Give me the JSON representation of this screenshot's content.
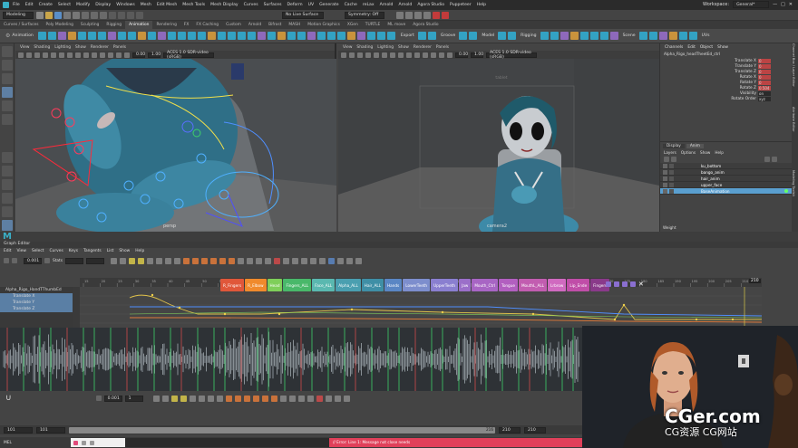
{
  "app": {
    "menu": [
      "File",
      "Edit",
      "Create",
      "Select",
      "Modify",
      "Display",
      "Windows",
      "Mesh",
      "Edit Mesh",
      "Mesh Tools",
      "Mesh Display",
      "Curves",
      "Surfaces",
      "Deform",
      "UV",
      "Generate",
      "Cache",
      "reLax",
      "Arnold",
      "Arnold",
      "Agora Studio",
      "Puppeteer",
      "Help"
    ],
    "workspace_label": "Workspace:",
    "workspace_value": "General*",
    "window_controls": [
      "—",
      "□",
      "✕"
    ]
  },
  "statusline": {
    "mode": "Modeling",
    "live_surface": "No Live Surface",
    "symmetry": "Symmetry: Off"
  },
  "shelf_tabs": [
    "Curves / Surfaces",
    "Poly Modeling",
    "Sculpting",
    "Rigging",
    "Animation",
    "Rendering",
    "FX",
    "FX Caching",
    "Custom",
    "Arnold",
    "Bifrost",
    "MASH",
    "Motion Graphics",
    "XGen",
    "TURTLE",
    "ML move",
    "Agora Studio"
  ],
  "shelf": {
    "animation_label": "Animation",
    "export_label": "Export",
    "groove_label": "Groove",
    "model_label": "Model",
    "rigging_label": "Rigging",
    "scene_label": "Scene",
    "uvs_label": "UVs"
  },
  "viewport_left": {
    "menu": [
      "View",
      "Shading",
      "Lighting",
      "Show",
      "Renderer",
      "Panels"
    ],
    "values": [
      "0.00",
      "1.00"
    ],
    "colorspace": "ACES 1.0 SDR-video (sRGB)",
    "camera": "persp"
  },
  "viewport_right": {
    "menu": [
      "View",
      "Shading",
      "Lighting",
      "Show",
      "Renderer",
      "Panels"
    ],
    "values": [
      "0.00",
      "1.00"
    ],
    "colorspace": "ACES 1.0 SDR-video (sRGB)",
    "top_label": "tablet",
    "camera": "camera2"
  },
  "channel_box": {
    "menu": [
      "Channels",
      "Edit",
      "Object",
      "Show"
    ],
    "object_name": "Alpha_Rigo_headTheetEd_ctrl",
    "channels": [
      {
        "name": "Translate X",
        "value": "0"
      },
      {
        "name": "Translate Y",
        "value": "0"
      },
      {
        "name": "Translate Z",
        "value": "0"
      },
      {
        "name": "Rotate X",
        "value": "0"
      },
      {
        "name": "Rotate Y",
        "value": "0"
      },
      {
        "name": "Rotate Z",
        "value": "0.504"
      },
      {
        "name": "Visibility",
        "value": "on"
      },
      {
        "name": "Rotate Order",
        "value": "xyz"
      }
    ],
    "side_tabs": [
      "Channel Box / Layer Editor",
      "Attribute Editor",
      "Modeling Toolkit"
    ],
    "layer_tabs": [
      "Display",
      "Anim"
    ],
    "layer_menu": [
      "Layers",
      "Options",
      "Show",
      "Help"
    ],
    "layers": [
      "ku_bottom",
      "bango_anim",
      "hair_anim",
      "upper_face",
      "BaseAnimation"
    ],
    "footer": "Weight"
  },
  "graph_editor": {
    "title": "Graph Editor",
    "menu": [
      "Edit",
      "View",
      "Select",
      "Curves",
      "Keys",
      "Tangents",
      "List",
      "Show",
      "Help"
    ],
    "field_value": "0.001",
    "stats_label": "Stats",
    "outliner_items": [
      "Alpha_Rigo_HandTThumbEd",
      "Translate X",
      "Translate Y",
      "Translate Z"
    ],
    "ruler_ticks": [
      "15",
      "20",
      "25",
      "30",
      "35",
      "40",
      "45",
      "50",
      "55",
      "60",
      "65",
      "70",
      "75",
      "80",
      "85",
      "90",
      "95",
      "100",
      "105",
      "110",
      "115",
      "120",
      "125",
      "130",
      "135",
      "140",
      "145",
      "150",
      "155",
      "160",
      "165",
      "170",
      "175",
      "180",
      "185",
      "190",
      "195",
      "200",
      "205",
      "210"
    ],
    "left_ruler": [
      "22",
      "20",
      "18",
      "16",
      "14",
      "12",
      "10"
    ],
    "chips": [
      {
        "label": "R_Fingers",
        "color": "#e0573a"
      },
      {
        "label": "R_Elbow",
        "color": "#f08a2c"
      },
      {
        "label": "Head",
        "color": "#7fcf5a"
      },
      {
        "label": "Fingers_ALL",
        "color": "#49b86a"
      },
      {
        "label": "Face_ALL",
        "color": "#5ab8b0"
      },
      {
        "label": "Alpha_ALL",
        "color": "#4a9fb0"
      },
      {
        "label": "Hair_ALL",
        "color": "#3f8fa6"
      },
      {
        "label": "Hands",
        "color": "#5a86c4"
      },
      {
        "label": "LowerTeeth",
        "color": "#7d8ecd"
      },
      {
        "label": "UpperTeeth",
        "color": "#8a7fd0"
      },
      {
        "label": "Jaw",
        "color": "#9b6fc9"
      },
      {
        "label": "Mouth_Ctrl",
        "color": "#a865c4"
      },
      {
        "label": "Tongue",
        "color": "#b25fc0"
      },
      {
        "label": "MouthL_ALL",
        "color": "#c25db0"
      },
      {
        "label": "Lrbrow",
        "color": "#d06ac0"
      },
      {
        "label": "Lip_Ende",
        "color": "#c04ea8"
      },
      {
        "label": "Fingers",
        "color": "#8a3a8a"
      }
    ],
    "frame_end": "210",
    "bottom_field": "0.001",
    "bottom_field2": "1",
    "range": {
      "start_outer": "101",
      "start_inner": "101",
      "current": "216",
      "end_inner": "210",
      "end_outer": "210"
    },
    "cmd_label": "MEL",
    "status_message": "// Error: Line 1: Message not close needs"
  },
  "watermark": {
    "brand": "CGer.com",
    "subtitle": "CG资源 CG网站"
  }
}
